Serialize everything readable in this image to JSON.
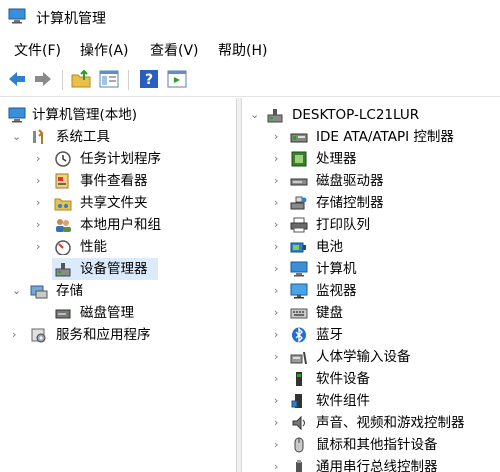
{
  "window": {
    "title": "计算机管理"
  },
  "menu": {
    "file": "文件(F)",
    "action": "操作(A)",
    "view": "查看(V)",
    "help": "帮助(H)"
  },
  "tree": {
    "root": "计算机管理(本地)",
    "system_tools": "系统工具",
    "task_scheduler": "任务计划程序",
    "event_viewer": "事件查看器",
    "shared_folders": "共享文件夹",
    "local_users": "本地用户和组",
    "performance": "性能",
    "device_manager": "设备管理器",
    "storage": "存储",
    "disk_management": "磁盘管理",
    "services_apps": "服务和应用程序"
  },
  "devices": {
    "computer_name": "DESKTOP-LC21LUR",
    "items": [
      {
        "label": "IDE ATA/ATAPI 控制器",
        "icon": "ide-controller-icon"
      },
      {
        "label": "处理器",
        "icon": "processor-icon"
      },
      {
        "label": "磁盘驱动器",
        "icon": "disk-drive-icon"
      },
      {
        "label": "存储控制器",
        "icon": "storage-controller-icon"
      },
      {
        "label": "打印队列",
        "icon": "printer-icon"
      },
      {
        "label": "电池",
        "icon": "battery-icon"
      },
      {
        "label": "计算机",
        "icon": "computer-icon"
      },
      {
        "label": "监视器",
        "icon": "monitor-icon"
      },
      {
        "label": "键盘",
        "icon": "keyboard-icon"
      },
      {
        "label": "蓝牙",
        "icon": "bluetooth-icon"
      },
      {
        "label": "人体学输入设备",
        "icon": "hid-icon"
      },
      {
        "label": "软件设备",
        "icon": "software-device-icon"
      },
      {
        "label": "软件组件",
        "icon": "software-component-icon"
      },
      {
        "label": "声音、视频和游戏控制器",
        "icon": "sound-icon"
      },
      {
        "label": "鼠标和其他指针设备",
        "icon": "mouse-icon"
      },
      {
        "label": "通用串行总线控制器",
        "icon": "usb-icon"
      }
    ]
  },
  "colors": {
    "accent": "#0078d7",
    "selection": "#dcebfc"
  }
}
